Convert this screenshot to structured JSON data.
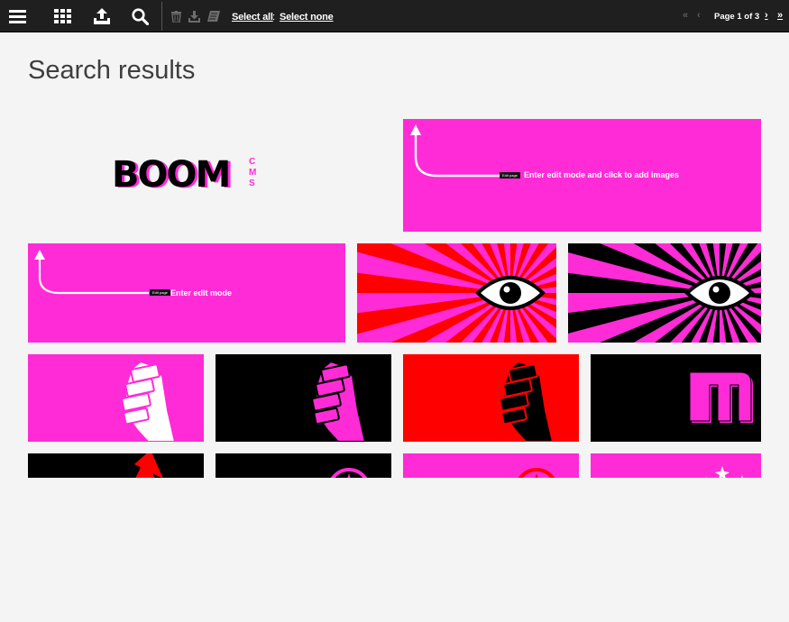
{
  "toolbar": {
    "icons": [
      "menu-icon",
      "grid-icon",
      "upload-icon",
      "search-icon",
      "trash-icon",
      "download-icon",
      "tag-icon"
    ],
    "select_all": "Select all",
    "separator": ":",
    "select_none": "Select none"
  },
  "pager": {
    "label": "Page 1 of 3",
    "first_icon": "first-page-icon",
    "prev_icon": "prev-page-icon",
    "next_icon": "next-page-icon",
    "last_icon": "last-page-icon"
  },
  "title": "Search results",
  "tiles": {
    "edit_images_text": "Enter edit mode and click to add images",
    "edit_page_badge": "Edit page",
    "edit_mode_text": "Enter edit mode",
    "logo_text": "BOOM",
    "logo_sub": "CMS"
  },
  "colors": {
    "toolbar": "#1f1f1f",
    "magenta": "#ff2bd7",
    "red": "#ff0000",
    "black": "#000000",
    "background": "#f4f4f4"
  }
}
